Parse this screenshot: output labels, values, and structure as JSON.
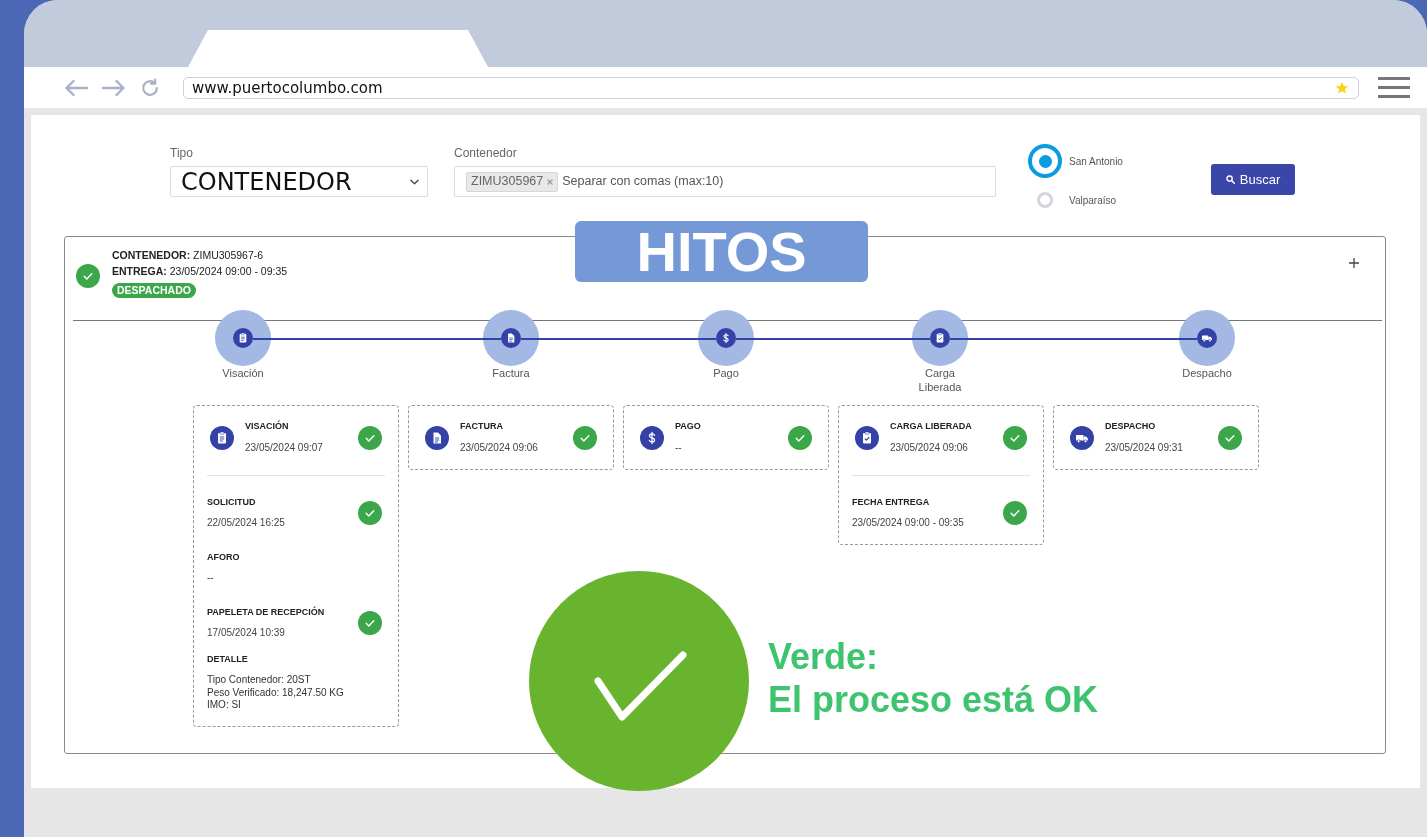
{
  "browser": {
    "url": "www.puertocolumbo.com",
    "bookmarked": true
  },
  "search_form": {
    "tipo": {
      "label": "Tipo",
      "value": "CONTENEDOR"
    },
    "contenedor": {
      "label": "Contenedor",
      "chips": [
        "ZIMU305967"
      ],
      "placeholder": "Separar con comas (max:10)"
    },
    "ports": [
      {
        "label": "San Antonio",
        "selected": true
      },
      {
        "label": "Valparaíso",
        "selected": false
      }
    ],
    "search_button": "Buscar"
  },
  "banner": {
    "title": "HITOS"
  },
  "container_card": {
    "done": true,
    "lines": [
      "**CONTENEDOR:** ZIMU305967-6",
      "**ENTREGA:** 23/05/2024 09:00 - 09:35"
    ],
    "status": "DESPACHADO",
    "timeline": [
      {
        "label": "Visación"
      },
      {
        "label": "Factura"
      },
      {
        "label": "Pago"
      },
      {
        "label": "Carga Liberada"
      },
      {
        "label": "Despacho"
      }
    ],
    "milestones": [
      {
        "title": "VISACIÓN",
        "value": "23/05/2024 09:07",
        "done": true,
        "steps": [
          {
            "title": "SOLICITUD",
            "value": "22/05/2024 16:25",
            "done": true
          },
          {
            "title": "AFORO",
            "value": "--",
            "done": false
          },
          {
            "title": "PAPELETA DE RECEPCIÓN",
            "value": "17/05/2024 10:39",
            "done": true
          }
        ],
        "detail": {
          "title": "DETALLE",
          "lines": [
            "Tipo Contenedor: 20ST",
            "Peso Verificado: 18,247.50 KG",
            "IMO: SI"
          ]
        }
      },
      {
        "title": "FACTURA",
        "value": "23/05/2024 09:06",
        "done": true
      },
      {
        "title": "PAGO",
        "value": "--",
        "done": true
      },
      {
        "title": "CARGA LIBERADA",
        "value": "23/05/2024 09:06",
        "done": true,
        "steps": [
          {
            "title": "FECHA ENTREGA",
            "value": "23/05/2024 09:00 - 09:35",
            "done": true
          }
        ]
      },
      {
        "title": "DESPACHO",
        "value": "23/05/2024 09:31",
        "done": true
      }
    ]
  },
  "legend": {
    "lines": [
      "Verde:",
      "El proceso está OK"
    ]
  }
}
